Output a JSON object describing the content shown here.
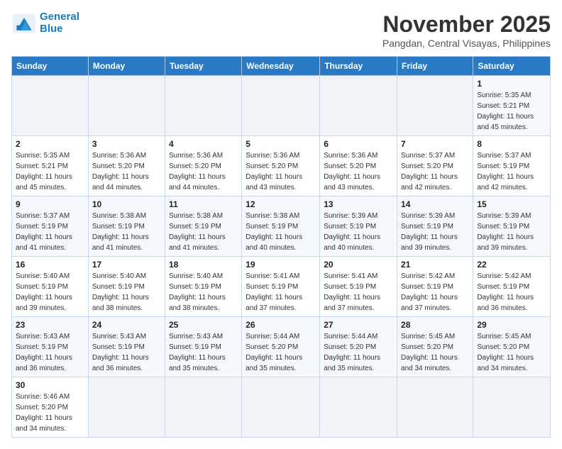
{
  "logo": {
    "general": "General",
    "blue": "Blue"
  },
  "header": {
    "month": "November 2025",
    "location": "Pangdan, Central Visayas, Philippines"
  },
  "days_of_week": [
    "Sunday",
    "Monday",
    "Tuesday",
    "Wednesday",
    "Thursday",
    "Friday",
    "Saturday"
  ],
  "weeks": [
    [
      {
        "day": "",
        "info": ""
      },
      {
        "day": "",
        "info": ""
      },
      {
        "day": "",
        "info": ""
      },
      {
        "day": "",
        "info": ""
      },
      {
        "day": "",
        "info": ""
      },
      {
        "day": "",
        "info": ""
      },
      {
        "day": "1",
        "info": "Sunrise: 5:35 AM\nSunset: 5:21 PM\nDaylight: 11 hours\nand 45 minutes."
      }
    ],
    [
      {
        "day": "2",
        "info": "Sunrise: 5:35 AM\nSunset: 5:21 PM\nDaylight: 11 hours\nand 45 minutes."
      },
      {
        "day": "3",
        "info": "Sunrise: 5:36 AM\nSunset: 5:20 PM\nDaylight: 11 hours\nand 44 minutes."
      },
      {
        "day": "4",
        "info": "Sunrise: 5:36 AM\nSunset: 5:20 PM\nDaylight: 11 hours\nand 44 minutes."
      },
      {
        "day": "5",
        "info": "Sunrise: 5:36 AM\nSunset: 5:20 PM\nDaylight: 11 hours\nand 43 minutes."
      },
      {
        "day": "6",
        "info": "Sunrise: 5:36 AM\nSunset: 5:20 PM\nDaylight: 11 hours\nand 43 minutes."
      },
      {
        "day": "7",
        "info": "Sunrise: 5:37 AM\nSunset: 5:20 PM\nDaylight: 11 hours\nand 42 minutes."
      },
      {
        "day": "8",
        "info": "Sunrise: 5:37 AM\nSunset: 5:19 PM\nDaylight: 11 hours\nand 42 minutes."
      }
    ],
    [
      {
        "day": "9",
        "info": "Sunrise: 5:37 AM\nSunset: 5:19 PM\nDaylight: 11 hours\nand 41 minutes."
      },
      {
        "day": "10",
        "info": "Sunrise: 5:38 AM\nSunset: 5:19 PM\nDaylight: 11 hours\nand 41 minutes."
      },
      {
        "day": "11",
        "info": "Sunrise: 5:38 AM\nSunset: 5:19 PM\nDaylight: 11 hours\nand 41 minutes."
      },
      {
        "day": "12",
        "info": "Sunrise: 5:38 AM\nSunset: 5:19 PM\nDaylight: 11 hours\nand 40 minutes."
      },
      {
        "day": "13",
        "info": "Sunrise: 5:39 AM\nSunset: 5:19 PM\nDaylight: 11 hours\nand 40 minutes."
      },
      {
        "day": "14",
        "info": "Sunrise: 5:39 AM\nSunset: 5:19 PM\nDaylight: 11 hours\nand 39 minutes."
      },
      {
        "day": "15",
        "info": "Sunrise: 5:39 AM\nSunset: 5:19 PM\nDaylight: 11 hours\nand 39 minutes."
      }
    ],
    [
      {
        "day": "16",
        "info": "Sunrise: 5:40 AM\nSunset: 5:19 PM\nDaylight: 11 hours\nand 39 minutes."
      },
      {
        "day": "17",
        "info": "Sunrise: 5:40 AM\nSunset: 5:19 PM\nDaylight: 11 hours\nand 38 minutes."
      },
      {
        "day": "18",
        "info": "Sunrise: 5:40 AM\nSunset: 5:19 PM\nDaylight: 11 hours\nand 38 minutes."
      },
      {
        "day": "19",
        "info": "Sunrise: 5:41 AM\nSunset: 5:19 PM\nDaylight: 11 hours\nand 37 minutes."
      },
      {
        "day": "20",
        "info": "Sunrise: 5:41 AM\nSunset: 5:19 PM\nDaylight: 11 hours\nand 37 minutes."
      },
      {
        "day": "21",
        "info": "Sunrise: 5:42 AM\nSunset: 5:19 PM\nDaylight: 11 hours\nand 37 minutes."
      },
      {
        "day": "22",
        "info": "Sunrise: 5:42 AM\nSunset: 5:19 PM\nDaylight: 11 hours\nand 36 minutes."
      }
    ],
    [
      {
        "day": "23",
        "info": "Sunrise: 5:43 AM\nSunset: 5:19 PM\nDaylight: 11 hours\nand 36 minutes."
      },
      {
        "day": "24",
        "info": "Sunrise: 5:43 AM\nSunset: 5:19 PM\nDaylight: 11 hours\nand 36 minutes."
      },
      {
        "day": "25",
        "info": "Sunrise: 5:43 AM\nSunset: 5:19 PM\nDaylight: 11 hours\nand 35 minutes."
      },
      {
        "day": "26",
        "info": "Sunrise: 5:44 AM\nSunset: 5:20 PM\nDaylight: 11 hours\nand 35 minutes."
      },
      {
        "day": "27",
        "info": "Sunrise: 5:44 AM\nSunset: 5:20 PM\nDaylight: 11 hours\nand 35 minutes."
      },
      {
        "day": "28",
        "info": "Sunrise: 5:45 AM\nSunset: 5:20 PM\nDaylight: 11 hours\nand 34 minutes."
      },
      {
        "day": "29",
        "info": "Sunrise: 5:45 AM\nSunset: 5:20 PM\nDaylight: 11 hours\nand 34 minutes."
      }
    ],
    [
      {
        "day": "30",
        "info": "Sunrise: 5:46 AM\nSunset: 5:20 PM\nDaylight: 11 hours\nand 34 minutes."
      },
      {
        "day": "",
        "info": ""
      },
      {
        "day": "",
        "info": ""
      },
      {
        "day": "",
        "info": ""
      },
      {
        "day": "",
        "info": ""
      },
      {
        "day": "",
        "info": ""
      },
      {
        "day": "",
        "info": ""
      }
    ]
  ]
}
